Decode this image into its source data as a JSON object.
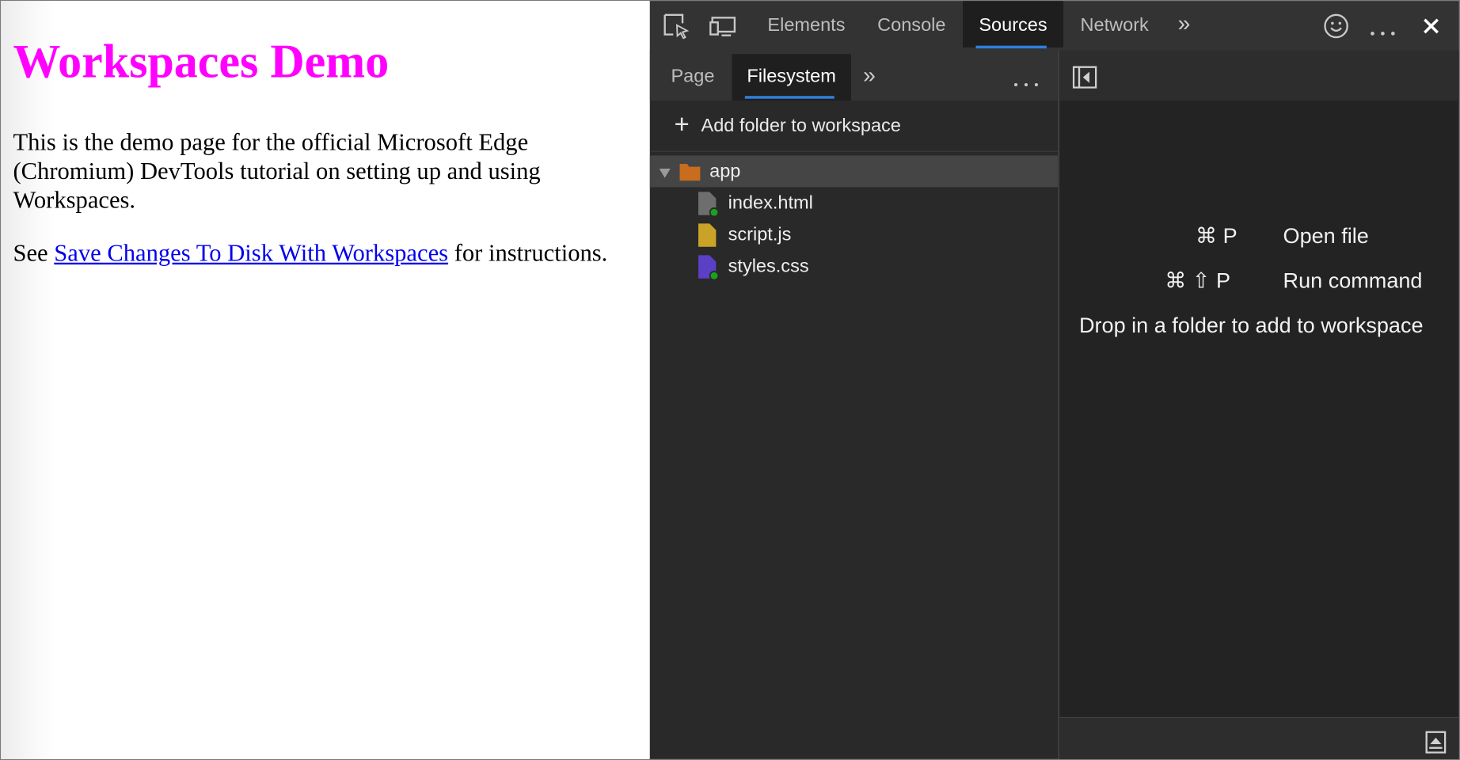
{
  "demo_page": {
    "heading": "Workspaces Demo",
    "paragraph": "This is the demo page for the official Microsoft Edge (Chromium) DevTools tutorial on setting up and using Workspaces.",
    "see_prefix": "See ",
    "link_text": "Save Changes To Disk With Workspaces",
    "see_suffix": " for instructions."
  },
  "devtools": {
    "toolbar": {
      "icons": [
        "inspect-element-icon",
        "device-emulation-icon"
      ],
      "tabs": [
        {
          "label": "Elements"
        },
        {
          "label": "Console"
        },
        {
          "label": "Sources",
          "active": true
        },
        {
          "label": "Network"
        }
      ],
      "more_tabs_glyph": "»",
      "right_icons": [
        "feedback-smiley-icon",
        "more-options-icon",
        "close-icon"
      ]
    },
    "navigator": {
      "tabs": [
        {
          "label": "Page"
        },
        {
          "label": "Filesystem",
          "active": true
        }
      ],
      "more_tabs_glyph": "»",
      "add_folder_label": "Add folder to workspace",
      "tree": {
        "folder": "app",
        "files": [
          {
            "name": "index.html",
            "color": "#6e6e6e",
            "mapped": true
          },
          {
            "name": "script.js",
            "color": "#c9a227",
            "mapped": false
          },
          {
            "name": "styles.css",
            "color": "#5b3fc4",
            "mapped": true
          }
        ]
      }
    },
    "editor": {
      "shortcuts": [
        {
          "keys": "⌘ P",
          "action": "Open file"
        },
        {
          "keys": "⌘ ⇧ P",
          "action": "Run command"
        }
      ],
      "drop_hint": "Drop in a folder to add to workspace"
    },
    "colors": {
      "accent": "#2f7fd9",
      "heading": "#ff00ff",
      "link": "#0000ee",
      "folder": "#c86c1e",
      "mapped_dot": "#1aa31a"
    }
  }
}
